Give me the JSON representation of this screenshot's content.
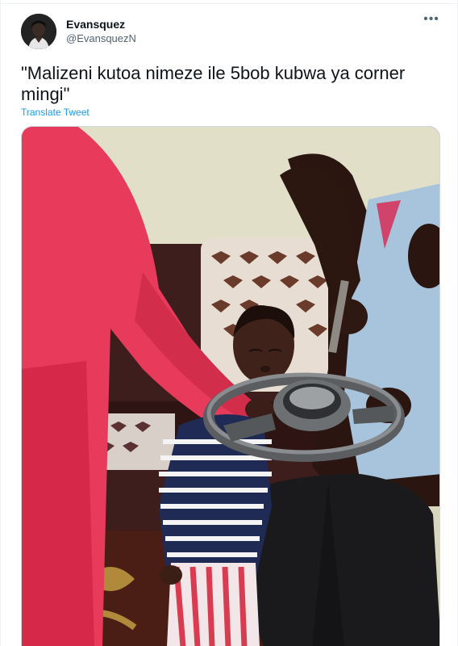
{
  "tweet": {
    "author_name": "Evansquez",
    "author_handle": "@EvansquezN",
    "more_icon": "more-horizontal-icon",
    "text": "\"Malizeni kutoa nimeze ile 5bob kubwa ya corner mingi\"",
    "translate_label": "Translate Tweet"
  },
  "colors": {
    "link": "#1d9bf0",
    "secondary_text": "#536471",
    "primary_text": "#0f1419",
    "border": "#cfd9de"
  }
}
